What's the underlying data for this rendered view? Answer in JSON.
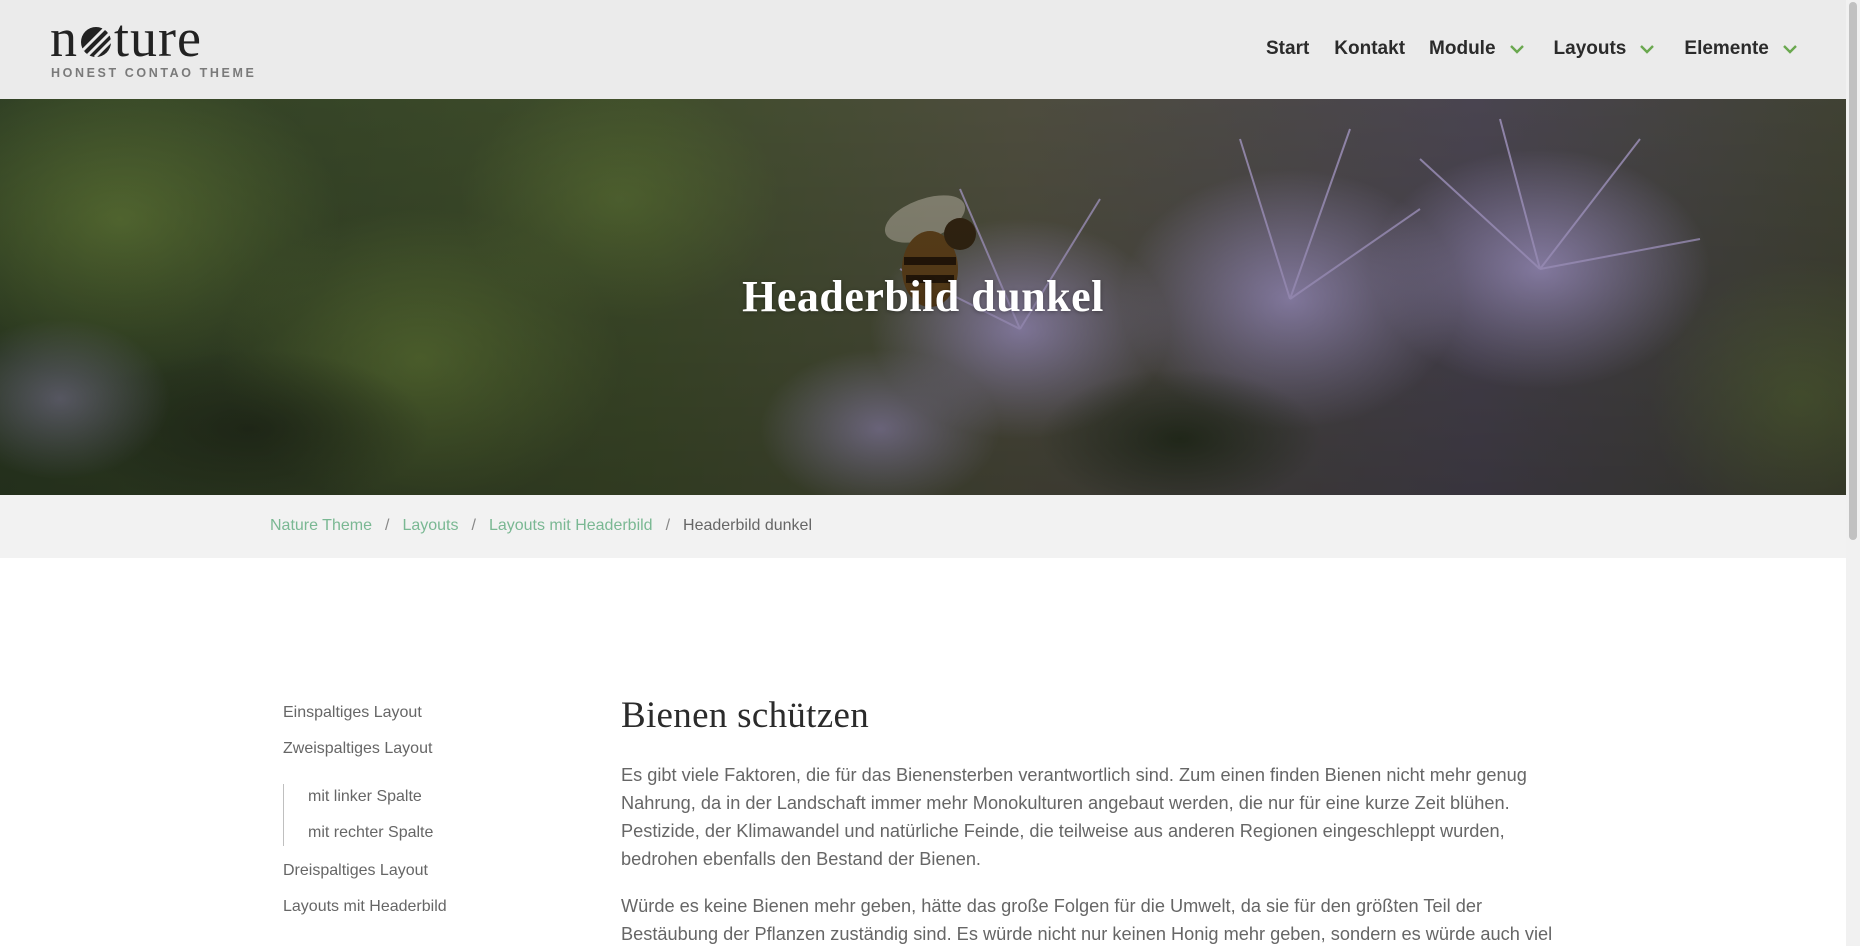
{
  "logo": {
    "word_before": "n",
    "word_after": "ture",
    "tagline": "HONEST CONTAO THEME"
  },
  "nav": {
    "items": [
      {
        "label": "Start",
        "has_dropdown": false
      },
      {
        "label": "Kontakt",
        "has_dropdown": false
      },
      {
        "label": "Module",
        "has_dropdown": true
      },
      {
        "label": "Layouts",
        "has_dropdown": true
      },
      {
        "label": "Elemente",
        "has_dropdown": true
      }
    ],
    "chevron_icon": "chevron-down-icon",
    "accent_color": "#6aa84f"
  },
  "hero": {
    "title": "Headerbild dunkel"
  },
  "breadcrumb": {
    "links": [
      "Nature Theme",
      "Layouts",
      "Layouts mit Headerbild"
    ],
    "separator": "/",
    "current": "Headerbild dunkel",
    "link_color": "#7ab893"
  },
  "sidebar": {
    "items": [
      "Einspaltiges Layout",
      "Zweispaltiges Layout"
    ],
    "subitems": [
      "mit linker Spalte",
      "mit rechter Spalte"
    ],
    "items_after": [
      "Dreispaltiges Layout",
      "Layouts mit Headerbild"
    ]
  },
  "main": {
    "heading": "Bienen schützen",
    "paragraphs": [
      "Es gibt viele Faktoren, die für das Bienensterben verantwortlich sind. Zum einen finden Bienen nicht mehr genug Nahrung, da in der Landschaft immer mehr Monokulturen angebaut werden, die nur für eine kurze Zeit blühen. Pestizide, der Klimawandel und natürliche Feinde, die teilweise aus anderen Regionen eingeschleppt wurden, bedrohen ebenfalls den Bestand der Bienen.",
      "Würde es keine Bienen mehr geben, hätte das große Folgen für die Umwelt, da sie für den größten Teil der Bestäubung der Pflanzen zuständig sind. Es würde nicht nur keinen Honig mehr geben, sondern es würde auch viel"
    ]
  }
}
